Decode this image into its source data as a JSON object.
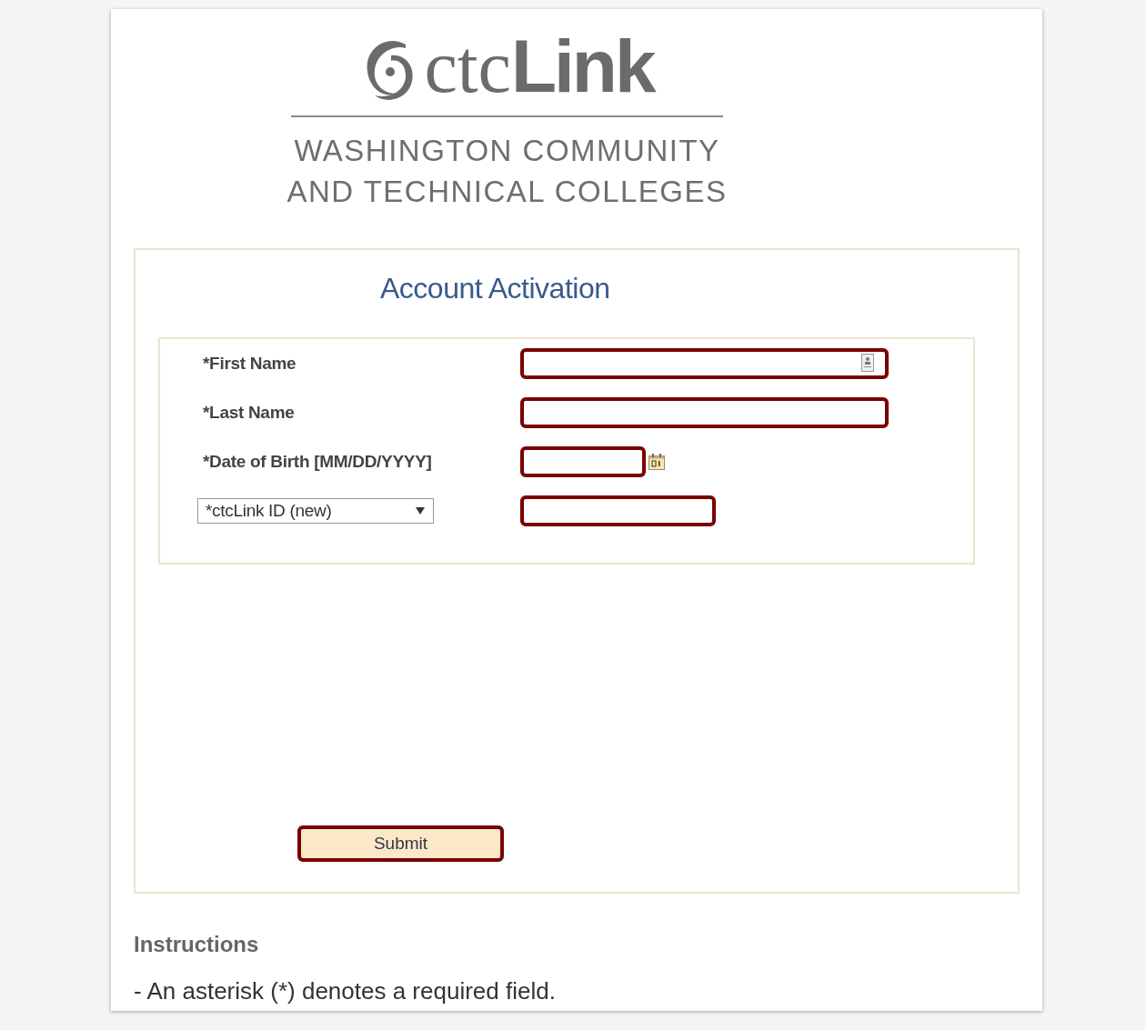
{
  "logo": {
    "prefix": "ctc",
    "name": "Link",
    "subtitle_lines": [
      "WASHINGTON COMMUNITY",
      "AND TECHNICAL COLLEGES"
    ]
  },
  "form": {
    "title": "Account Activation",
    "fields": [
      {
        "kind": "lookup",
        "label": "*First Name"
      },
      {
        "kind": "text",
        "label": "*Last Name"
      },
      {
        "kind": "date",
        "label": "*Date of Birth [MM/DD/YYYY]"
      },
      {
        "kind": "select",
        "label": "*ctcLink ID (new)"
      }
    ],
    "submit": "Submit"
  },
  "instructions": {
    "title": "Instructions",
    "text": "- An asterisk (*) denotes a required field."
  }
}
